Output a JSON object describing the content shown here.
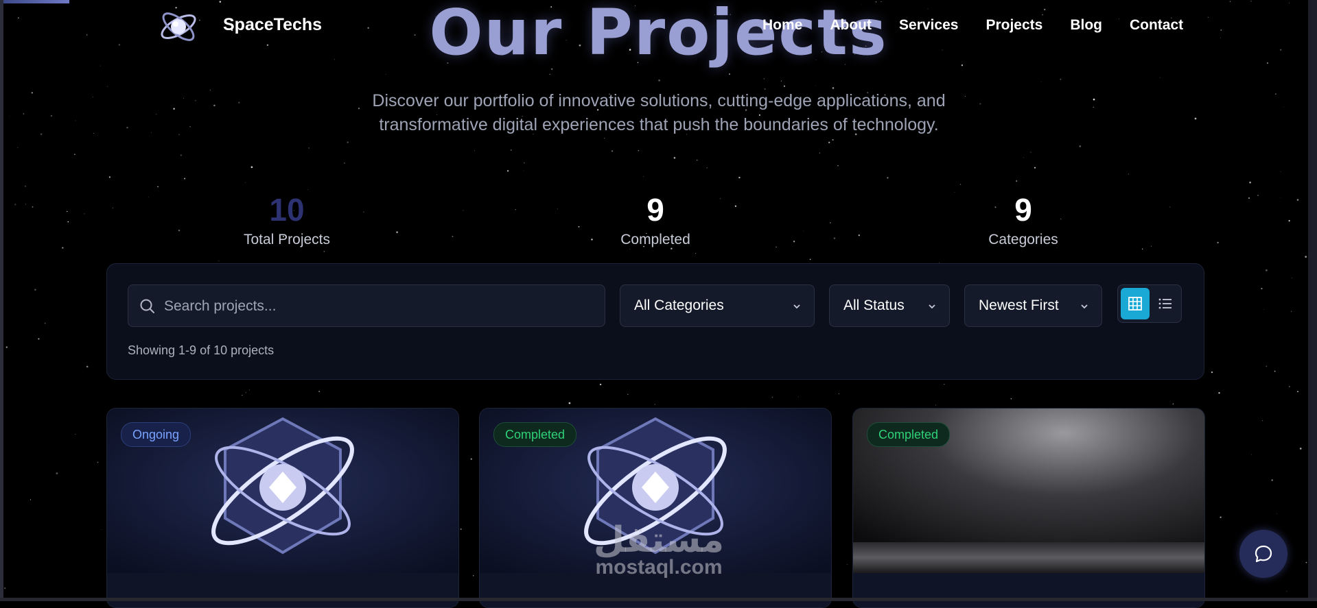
{
  "brand": {
    "name": "SpaceTechs"
  },
  "nav": {
    "items": [
      "Home",
      "About",
      "Services",
      "Projects",
      "Blog",
      "Contact"
    ]
  },
  "hero": {
    "title": "Our Projects",
    "subtitle": "Discover our portfolio of innovative solutions, cutting-edge applications, and transformative digital experiences that push the boundaries of technology."
  },
  "stats": [
    {
      "value": "10",
      "label": "Total Projects"
    },
    {
      "value": "9",
      "label": "Completed"
    },
    {
      "value": "9",
      "label": "Categories"
    }
  ],
  "filters": {
    "search_placeholder": "Search projects...",
    "category": "All Categories",
    "status": "All Status",
    "sort": "Newest First",
    "view_mode": "grid",
    "showing": "Showing 1-9 of 10 projects"
  },
  "cards": [
    {
      "status": "Ongoing",
      "image": "atom-emblem"
    },
    {
      "status": "Completed",
      "image": "atom-emblem"
    },
    {
      "status": "Completed",
      "image": "gray-studio-backdrop"
    }
  ],
  "watermark": {
    "arabic": "مستقل",
    "latin": "mostaql.com"
  },
  "colors": {
    "background": "#000000",
    "accent": "#19a9d4",
    "hero_title": "#9a9fd3",
    "stat_highlight": "#2c3272",
    "ongoing": "#7aa3ff",
    "completed": "#2fd277"
  }
}
